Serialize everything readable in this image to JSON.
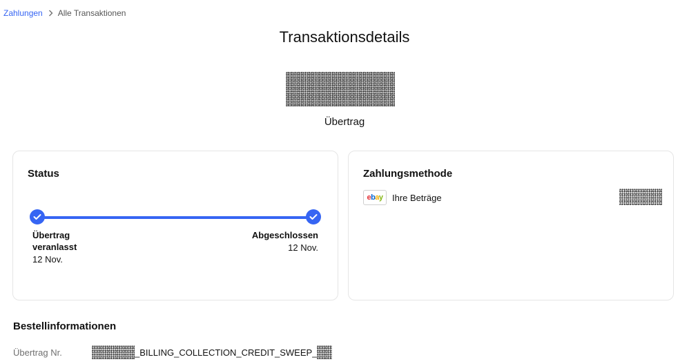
{
  "breadcrumb": {
    "link": "Zahlungen",
    "current": "Alle Transaktionen"
  },
  "page": {
    "title": "Transaktionsdetails",
    "transaction_type": "Übertrag"
  },
  "status": {
    "title": "Status",
    "steps": [
      {
        "label": "Übertrag veranlasst",
        "date": "12 Nov."
      },
      {
        "label": "Abgeschlossen",
        "date": "12 Nov."
      }
    ],
    "progress": 1.0,
    "accent_color": "#3665f3"
  },
  "payment_method": {
    "title": "Zahlungsmethode",
    "icon": "ebay-logo",
    "label": "Ihre Beträge"
  },
  "order_info": {
    "title": "Bestellinformationen",
    "transfer_number_label": "Übertrag Nr.",
    "transfer_number_visible": "_BILLING_COLLECTION_CREDIT_SWEEP_"
  }
}
